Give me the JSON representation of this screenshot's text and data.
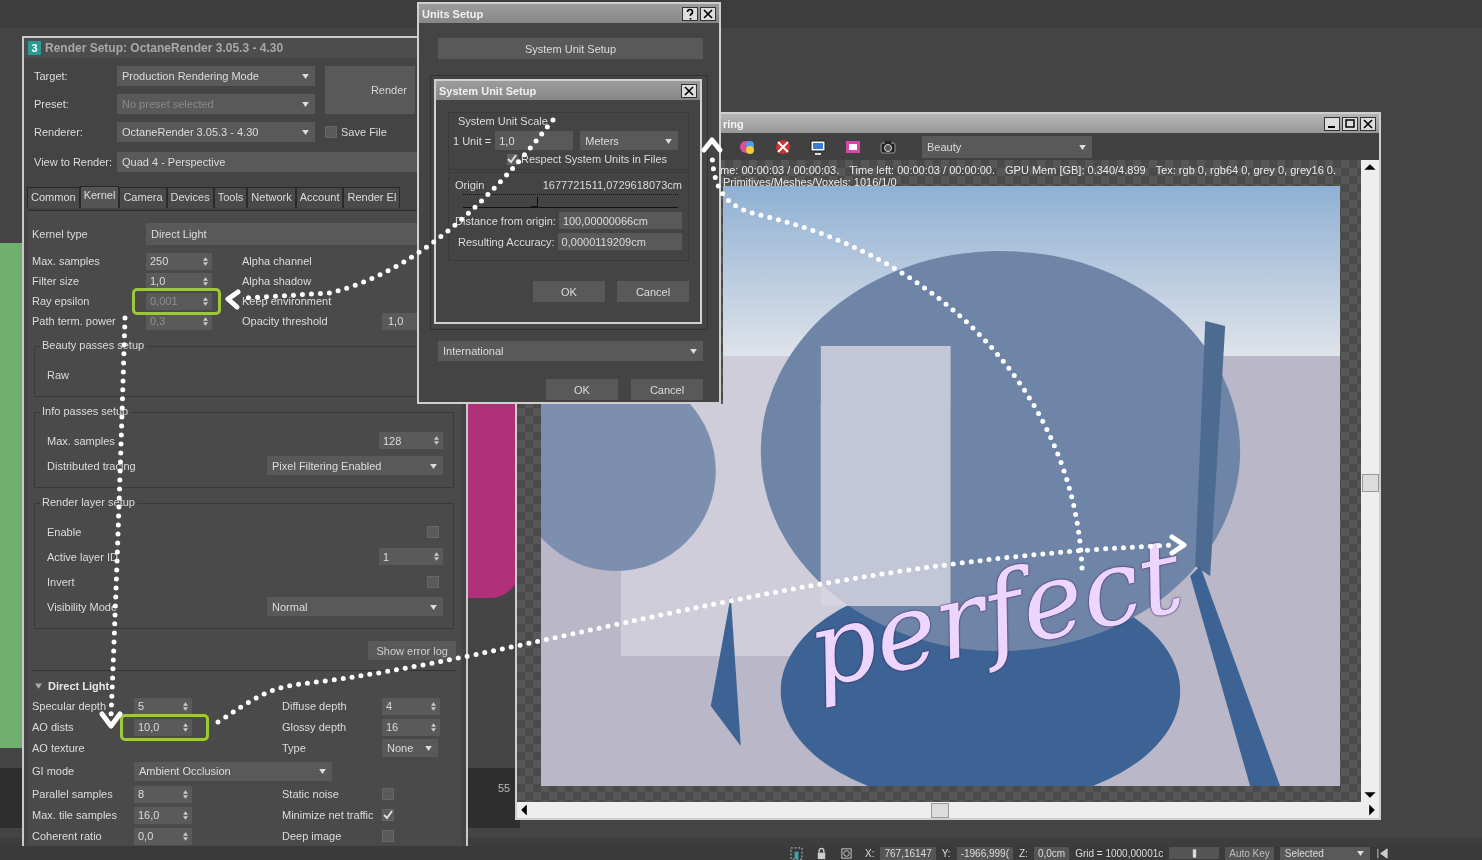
{
  "viewport": {
    "ruler_label": "55"
  },
  "render_setup": {
    "app_icon": "3",
    "title": "Render Setup: OctaneRender 3.05.3 - 4.30",
    "header_rows": [
      {
        "label": "Target:",
        "value": "Production Rendering Mode",
        "disabled": false
      },
      {
        "label": "Preset:",
        "value": "No preset selected",
        "disabled": true
      },
      {
        "label": "Renderer:",
        "value": "OctaneRender 3.05.3 - 4.30",
        "disabled": false
      }
    ],
    "render_button": "Render",
    "save_file": {
      "label": "Save File",
      "checked": false
    },
    "view_to_render": {
      "label": "View to Render:",
      "value": "Quad 4 - Perspective"
    },
    "tabs": [
      {
        "label": "Common",
        "selected": false
      },
      {
        "label": "Kernel",
        "selected": true
      },
      {
        "label": "Camera",
        "selected": false
      },
      {
        "label": "Devices",
        "selected": false
      },
      {
        "label": "Tools",
        "selected": false
      },
      {
        "label": "Network",
        "selected": false
      },
      {
        "label": "Account",
        "selected": false
      },
      {
        "label": "Render El",
        "selected": false
      }
    ],
    "kernel_type": {
      "label": "Kernel type",
      "value": "Direct Light"
    },
    "kernel_rows": [
      {
        "label": "Max. samples",
        "value": "250",
        "disabled": false,
        "right_label": "Alpha channel"
      },
      {
        "label": "Filter size",
        "value": "1,0",
        "disabled": false,
        "right_label": "Alpha shadow"
      },
      {
        "label": "Ray epsilon",
        "value": "0,001",
        "disabled": true,
        "highlighted": true,
        "right_label": "Keep environment"
      },
      {
        "label": "Path term. power",
        "value": "0,3",
        "disabled": true,
        "right_label": "Opacity threshold",
        "right_value": "1,0"
      }
    ],
    "groups": [
      {
        "title": "Beauty passes setup",
        "fields": [
          {
            "kind": "label",
            "label": "Raw"
          }
        ]
      },
      {
        "title": "Info passes setup",
        "fields": [
          {
            "kind": "spinner",
            "label": "Max. samples",
            "value": "128"
          },
          {
            "kind": "dropdown",
            "label": "Distributed tracing",
            "value": "Pixel Filtering Enabled"
          }
        ]
      },
      {
        "title": "Render layer setup",
        "fields": [
          {
            "kind": "checkbox",
            "label": "Enable",
            "checked": false
          },
          {
            "kind": "spinner",
            "label": "Active layer ID",
            "value": "1"
          },
          {
            "kind": "checkbox",
            "label": "Invert",
            "checked": false
          },
          {
            "kind": "dropdown",
            "label": "Visibility Mode",
            "value": "Normal"
          }
        ]
      }
    ],
    "show_error_log": "Show error log",
    "direct_light": {
      "title": "Direct Light",
      "expanded": true,
      "rows": [
        {
          "left": {
            "kind": "spinner",
            "label": "Specular depth",
            "value": "5"
          },
          "right": {
            "kind": "spinner",
            "label": "Diffuse depth",
            "value": "4"
          }
        },
        {
          "left": {
            "kind": "spinner",
            "label": "AO dists",
            "value": "10,0",
            "highlighted": true
          },
          "right": {
            "kind": "spinner",
            "label": "Glossy depth",
            "value": "16"
          }
        },
        {
          "left": {
            "kind": "label",
            "label": "AO texture"
          },
          "right": {
            "kind": "dropdown",
            "label": "Type",
            "value": "None"
          }
        },
        {
          "left": {
            "kind": "dropdown",
            "label": "GI mode",
            "value": "Ambient Occlusion"
          }
        },
        {
          "left": {
            "kind": "spinner",
            "label": "Parallel samples",
            "value": "8"
          },
          "right": {
            "kind": "checkbox",
            "label": "Static noise",
            "checked": false
          }
        },
        {
          "left": {
            "kind": "spinner",
            "label": "Max. tile samples",
            "value": "16,0"
          },
          "right": {
            "kind": "checkbox",
            "label": "Minimize net traffic",
            "checked": true
          }
        },
        {
          "left": {
            "kind": "spinner",
            "label": "Coherent ratio",
            "value": "0,0"
          },
          "right": {
            "kind": "checkbox",
            "label": "Deep image",
            "checked": false
          }
        }
      ]
    }
  },
  "frame_buffer": {
    "title": "ring",
    "channel": "Beauty",
    "info": [
      "me: 00:00:03 / 00:00:03.",
      "Time left: 00:00:03 / 00:00:00.",
      "GPU Mem [GB]: 0.340/4.899",
      "Tex: rgb 0, rgb64 0, grey 0, grey16 0."
    ],
    "info_line2": "Primitives/Meshes/Voxels: 1016/1/0",
    "note": "perfect"
  },
  "units_setup": {
    "title": "Units Setup",
    "system_button": "System Unit Setup",
    "lighting_units": "International",
    "ok": "OK",
    "cancel": "Cancel"
  },
  "system_unit_setup": {
    "title": "System Unit Setup",
    "group_title": "System Unit Scale",
    "unit_label": "1 Unit =",
    "unit_value": "1,0",
    "unit": "Meters",
    "respect": {
      "label": "Respect System Units in Files",
      "checked": true
    },
    "origin_label": "Origin",
    "origin_value": "1677721511,0729618073cm",
    "origin_slider": {
      "level": 0.33
    },
    "distance_label": "Distance from origin:",
    "distance_value": "100,00000066cm",
    "accuracy_label": "Resulting Accuracy:",
    "accuracy_value": "0,0000119209cm",
    "ok": "OK",
    "cancel": "Cancel"
  },
  "status_bar": {
    "x_label": "X:",
    "x_value": "767,16147",
    "y_label": "Y:",
    "y_value": "-1966,999(",
    "z_label": "Z:",
    "z_value": "0,0cm",
    "grid": "Grid = 1000,00001c",
    "auto_key": "Auto Key",
    "selection": "Selected"
  }
}
